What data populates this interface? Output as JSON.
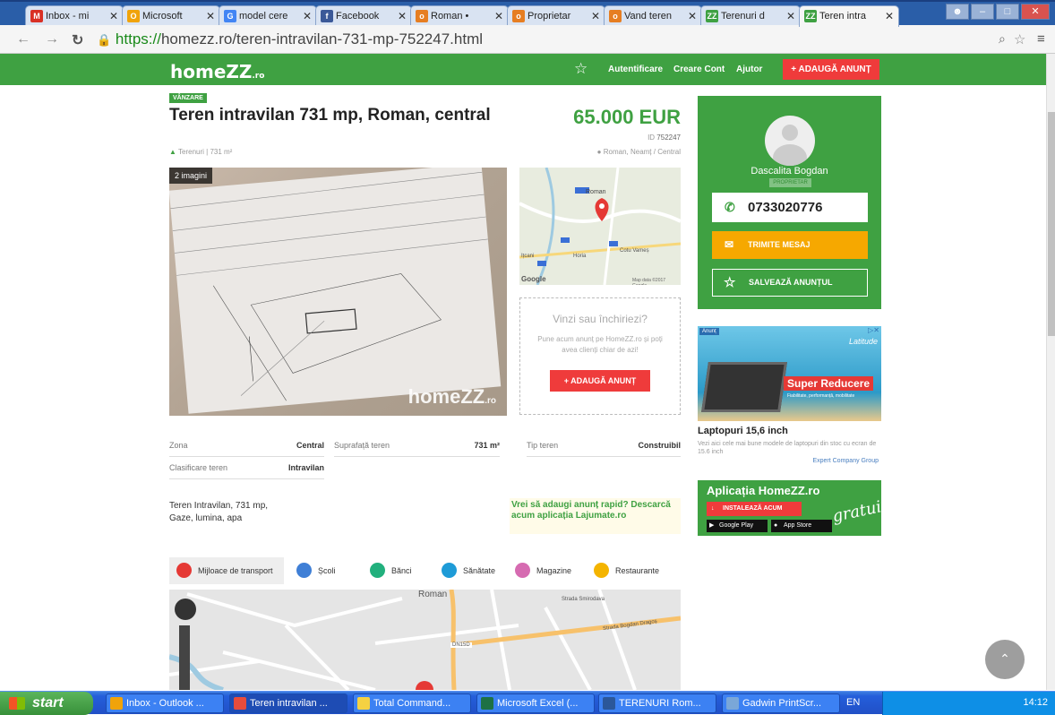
{
  "browser": {
    "tabs": [
      {
        "label": "Inbox - mi",
        "icon": "gmail-icon",
        "color": "#d93025",
        "glyph": "M"
      },
      {
        "label": "Microsoft",
        "icon": "outlook-icon",
        "color": "#f0a30a",
        "glyph": "O"
      },
      {
        "label": "model cere",
        "icon": "google-icon",
        "color": "#4285f4",
        "glyph": "G"
      },
      {
        "label": "Facebook",
        "icon": "facebook-icon",
        "color": "#3b5998",
        "glyph": "f"
      },
      {
        "label": "Roman •",
        "icon": "olx-icon",
        "color": "#e67e22",
        "glyph": "o"
      },
      {
        "label": "Proprietar",
        "icon": "olx-icon",
        "color": "#e67e22",
        "glyph": "o"
      },
      {
        "label": "Vand teren",
        "icon": "olx-icon",
        "color": "#e67e22",
        "glyph": "o"
      },
      {
        "label": "Terenuri d",
        "icon": "homezz-icon",
        "color": "#3fa142",
        "glyph": "ZZ"
      },
      {
        "label": "Teren intra",
        "icon": "homezz-icon",
        "color": "#3fa142",
        "glyph": "ZZ",
        "active": true
      }
    ],
    "url_scheme": "https://",
    "url_rest": "homezz.ro/teren-intravilan-731-mp-752247.html"
  },
  "header": {
    "logo": "homeZZ",
    "logo_suffix": ".ro",
    "login": "Autentificare",
    "create_account": "Creare Cont",
    "help": "Ajutor",
    "add_listing": "+ ADAUGĂ ANUNȚ"
  },
  "listing": {
    "badge": "VÂNZARE",
    "title": "Teren intravilan 731 mp, Roman, central",
    "price": "65.000 EUR",
    "id_label": "ID",
    "id": "752247",
    "category": "Terenuri",
    "area_short": "731 m²",
    "location": "Roman, Neamț / Central",
    "image_count": "2 imagini",
    "watermark": "homeZZ",
    "watermark_suffix": ".ro"
  },
  "sell_box": {
    "question": "Vinzi sau închiriezi?",
    "description": "Pune acum anunț pe HomeZZ.ro și poți avea clienți chiar de azi!",
    "button": "+ ADAUGĂ ANUNȚ"
  },
  "map_preview": {
    "city": "Roman",
    "google": "Google",
    "credit": "Map data ©2017 Google",
    "place1": "Ițcani",
    "place2": "Horia",
    "place3": "Cotu Vameș"
  },
  "specs": {
    "zona_label": "Zona",
    "zona_value": "Central",
    "suprafata_label": "Suprafață teren",
    "suprafata_value": "731 m²",
    "tip_label": "Tip teren",
    "tip_value": "Construibil",
    "clasificare_label": "Clasificare teren",
    "clasificare_value": "Intravilan"
  },
  "description": "Teren Intravilan, 731 mp,\nGaze, lumina, apa",
  "promo": "Vrei să adaugi anunț rapid? Descarcă acum aplicația Lajumate.ro",
  "poi_tabs": [
    {
      "label": "Mijloace de transport",
      "color": "#e53935",
      "icon": "bus-icon"
    },
    {
      "label": "Școli",
      "color": "#3f7fd6",
      "icon": "school-icon"
    },
    {
      "label": "Bănci",
      "color": "#22b07d",
      "icon": "bank-icon"
    },
    {
      "label": "Sănătate",
      "color": "#1e9bd7",
      "icon": "health-icon"
    },
    {
      "label": "Magazine",
      "color": "#d66bb1",
      "icon": "shop-icon"
    },
    {
      "label": "Restaurante",
      "color": "#f4b400",
      "icon": "restaurant-icon"
    }
  ],
  "street_map": {
    "city": "Roman",
    "road": "DN15D",
    "street1": "Strada Bogdan Dragoș",
    "street2": "Strada Smirodava"
  },
  "agent": {
    "name": "Dascalita Bogdan",
    "role": "PROPRIETAR",
    "phone": "0733020776",
    "message": "TRIMITE MESAJ",
    "save": "SALVEAZĂ ANUNȚUL"
  },
  "ad": {
    "label": "Anunț",
    "brand": "Latitude",
    "headline": "Super Reducere",
    "sub": "Fiabilitate, performanță, mobilitate",
    "title": "Laptopuri 15,6 inch",
    "description": "Vezi aici cele mai bune modele de laptopuri din stoc cu ecran de 15.6 inch",
    "source": "Expert Company Group"
  },
  "app_promo": {
    "title": "Aplicația HomeZZ.ro",
    "install": "INSTALEAZĂ ACUM",
    "google_play": "Google Play",
    "app_store": "App Store",
    "free": "gratuit"
  },
  "taskbar": {
    "start": "start",
    "tasks": [
      {
        "label": "Inbox - Outlook ...",
        "color": "#f0a30a"
      },
      {
        "label": "Teren intravilan ...",
        "color": "#e74c3c",
        "active": true
      },
      {
        "label": "Total Command...",
        "color": "#f5d142"
      },
      {
        "label": "Microsoft Excel (...",
        "color": "#1e7145"
      },
      {
        "label": "TERENURI Rom...",
        "color": "#2b579a"
      },
      {
        "label": "Gadwin PrintScr...",
        "color": "#7aa7d8"
      }
    ],
    "language": "EN",
    "clock": "14:12"
  }
}
